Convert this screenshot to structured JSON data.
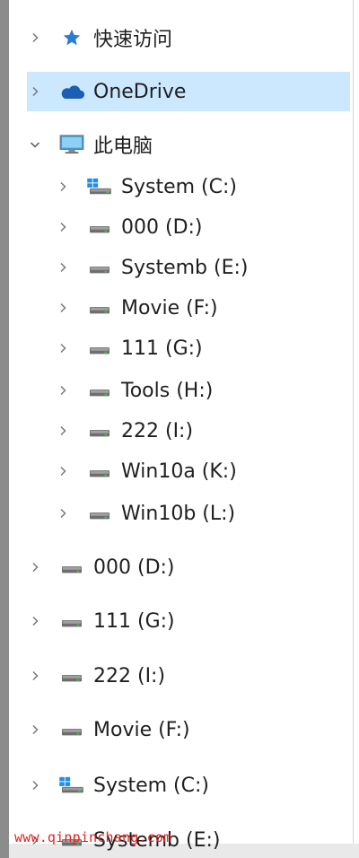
{
  "nav": {
    "quick_access": {
      "label": "快速访问",
      "icon": "star-icon",
      "expanded": false
    },
    "onedrive": {
      "label": "OneDrive",
      "icon": "cloud-icon",
      "expanded": false,
      "selected": true
    },
    "this_pc": {
      "label": "此电脑",
      "icon": "monitor-icon",
      "expanded": true
    },
    "pc_drives": [
      {
        "label": "System (C:)",
        "icon": "windows-drive-icon"
      },
      {
        "label": "000 (D:)",
        "icon": "drive-icon"
      },
      {
        "label": "Systemb (E:)",
        "icon": "drive-icon"
      },
      {
        "label": "Movie (F:)",
        "icon": "drive-icon"
      },
      {
        "label": "111 (G:)",
        "icon": "drive-icon"
      },
      {
        "label": "Tools (H:)",
        "icon": "drive-icon"
      },
      {
        "label": "222 (I:)",
        "icon": "drive-icon"
      },
      {
        "label": "Win10a (K:)",
        "icon": "drive-icon"
      },
      {
        "label": "Win10b (L:)",
        "icon": "drive-icon"
      }
    ],
    "top_drives": [
      {
        "label": "000 (D:)",
        "icon": "drive-icon"
      },
      {
        "label": "111 (G:)",
        "icon": "drive-icon"
      },
      {
        "label": "222 (I:)",
        "icon": "drive-icon"
      },
      {
        "label": "Movie (F:)",
        "icon": "drive-icon"
      },
      {
        "label": "System (C:)",
        "icon": "windows-drive-icon"
      },
      {
        "label": "Systemb (E:)",
        "icon": "drive-icon"
      }
    ]
  },
  "watermark": "www.qinpinchang.com",
  "colors": {
    "selection": "#cce8ff",
    "accent": "#0078d7",
    "watermark": "#e8201a"
  }
}
